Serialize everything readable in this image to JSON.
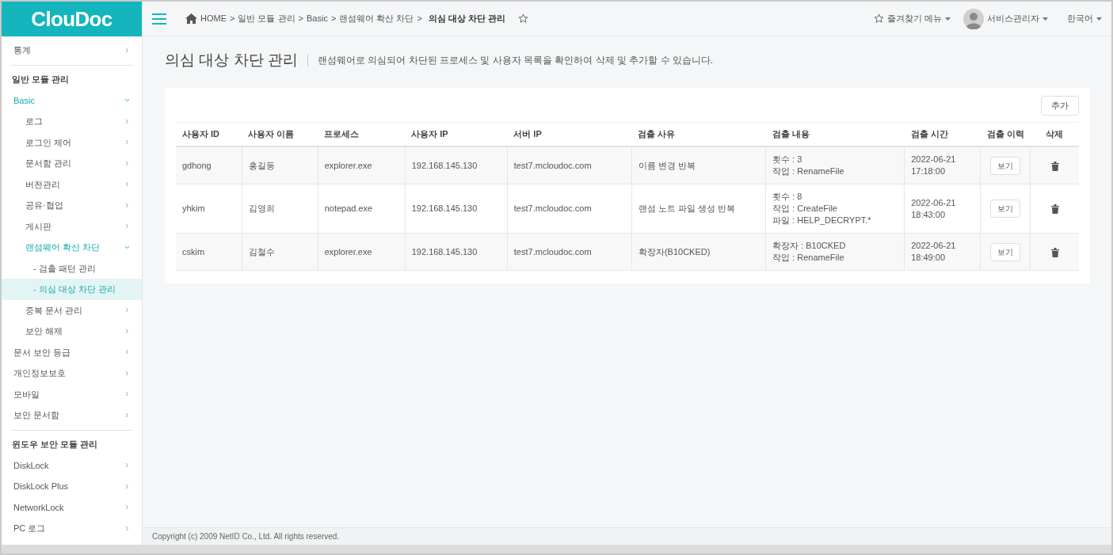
{
  "logo": {
    "text": "ClouDoc"
  },
  "header": {
    "breadcrumb_separator": ">",
    "breadcrumb": [
      "HOME",
      "일반 모듈 관리",
      "Basic",
      "랜섬웨어 확산 차단",
      "의심 대상 차단 관리"
    ],
    "favorites_menu": "즐겨찾기 메뉴",
    "user_menu": "서비스관리자",
    "language_menu": "한국어"
  },
  "sidebar": {
    "sections": [
      {
        "items": [
          {
            "label": "통계",
            "expanded": false,
            "selected": false
          }
        ]
      },
      {
        "title": "일반 모듈 관리",
        "items": [
          {
            "label": "Basic",
            "expanded": true,
            "selected": false,
            "children": [
              {
                "label": "로그",
                "expanded": false,
                "selected": false
              },
              {
                "label": "로그인 제어",
                "expanded": false,
                "selected": false
              },
              {
                "label": "문서함 관리",
                "expanded": false,
                "selected": false
              },
              {
                "label": "버전관리",
                "expanded": false,
                "selected": false
              },
              {
                "label": "공유·협업",
                "expanded": false,
                "selected": false
              },
              {
                "label": "게시판",
                "expanded": false,
                "selected": false
              },
              {
                "label": "랜섬웨어 확산 차단",
                "expanded": true,
                "selected": false,
                "children": [
                  {
                    "label": "- 검출 패턴 관리",
                    "selected": false
                  },
                  {
                    "label": "- 의심 대상 차단 관리",
                    "selected": true
                  }
                ]
              },
              {
                "label": "중복 문서 관리",
                "expanded": false,
                "selected": false
              },
              {
                "label": "보안 해제",
                "expanded": false,
                "selected": false
              }
            ]
          },
          {
            "label": "문서 보안 등급",
            "expanded": false,
            "selected": false
          },
          {
            "label": "개인정보보호",
            "expanded": false,
            "selected": false
          },
          {
            "label": "모바일",
            "expanded": false,
            "selected": false
          },
          {
            "label": "보안 문서함",
            "expanded": false,
            "selected": false
          }
        ]
      },
      {
        "title": "윈도우 보안 모듈 관리",
        "items": [
          {
            "label": "DiskLock",
            "expanded": false,
            "selected": false
          },
          {
            "label": "DiskLock Plus",
            "expanded": false,
            "selected": false
          },
          {
            "label": "NetworkLock",
            "expanded": false,
            "selected": false
          },
          {
            "label": "PC 로그",
            "expanded": false,
            "selected": false
          }
        ]
      }
    ]
  },
  "page": {
    "title": "의심 대상 차단 관리",
    "description": "랜섬웨어로 의심되어 차단된 프로세스 및 사용자 목록을 확인하여 삭제 및 추가할 수 있습니다.",
    "add_button": "추가"
  },
  "table": {
    "columns": [
      "사용자 ID",
      "사용자 이름",
      "프로세스",
      "사용자 IP",
      "서버 IP",
      "검출 사유",
      "검출 내용",
      "검출 시간",
      "검출 이력",
      "삭제"
    ],
    "rows": [
      {
        "user_id": "gdhong",
        "user_name": "홍길동",
        "process": "explorer.exe",
        "user_ip": "192.168.145.130",
        "server_ip": "test7.mcloudoc.com",
        "reason": "이름 변경 반복",
        "details": [
          "횟수 : 3",
          "작업 : RenameFile"
        ],
        "date": "2022-06-21",
        "time": "17:18:00",
        "history_button": "보기"
      },
      {
        "user_id": "yhkim",
        "user_name": "김영희",
        "process": "notepad.exe",
        "user_ip": "192.168.145.130",
        "server_ip": "test7.mcloudoc.com",
        "reason": "랜섬 노트 파일 생성 반복",
        "details": [
          "횟수 : 8",
          "작업 : CreateFile",
          "파일 : HELP_DECRYPT.*"
        ],
        "date": "2022-06-21",
        "time": "18:43:00",
        "history_button": "보기"
      },
      {
        "user_id": "cskim",
        "user_name": "김철수",
        "process": "explorer.exe",
        "user_ip": "192.168.145.130",
        "server_ip": "test7.mcloudoc.com",
        "reason": "확장자(B10CKED)",
        "details": [
          "확장자 : B10CKED",
          "작업 : RenameFile"
        ],
        "date": "2022-06-21",
        "time": "18:49:00",
        "history_button": "보기"
      }
    ]
  },
  "footer": {
    "copyright": "Copyright (c) 2009 NetID Co., Ltd. All rights reserved."
  }
}
